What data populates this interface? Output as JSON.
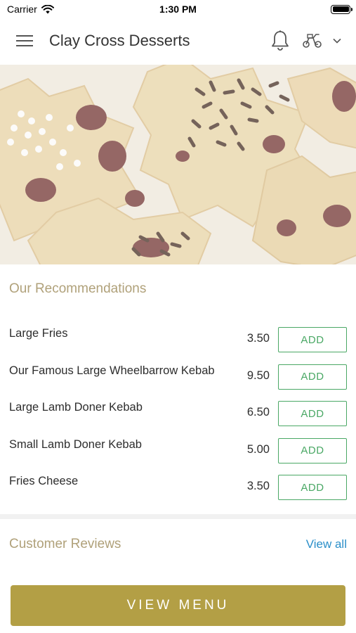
{
  "status_bar": {
    "carrier": "Carrier",
    "time": "1:30 PM",
    "wifi_icon": "wifi-icon",
    "battery_icon": "battery-icon",
    "battery_level": 1.0
  },
  "header": {
    "title": "Clay Cross Desserts",
    "menu_icon": "hamburger-menu-icon",
    "notification_icon": "bell-icon",
    "order_mode_icon": "scooter-icon",
    "dropdown_icon": "chevron-down-icon"
  },
  "hero": {
    "image": "cookies with raisins and chocolate sprinkles"
  },
  "recommendations": {
    "title": "Our Recommendations",
    "items": [
      {
        "name": "Large Fries",
        "price": "3.50",
        "button": "ADD"
      },
      {
        "name": "Our Famous Large Wheelbarrow Kebab",
        "price": "9.50",
        "button": "ADD"
      },
      {
        "name": "Large Lamb Doner Kebab",
        "price": "6.50",
        "button": "ADD"
      },
      {
        "name": "Small Lamb Doner Kebab",
        "price": "5.00",
        "button": "ADD"
      },
      {
        "name": "Fries Cheese",
        "price": "3.50",
        "button": "ADD"
      }
    ]
  },
  "reviews": {
    "title": "Customer Reviews",
    "view_all": "View all"
  },
  "footer": {
    "view_menu": "VIEW MENU"
  },
  "colors": {
    "accent_gold": "#b39f45",
    "section_title": "#b0a17a",
    "add_green": "#4aa865",
    "link_blue": "#2b8fc9"
  }
}
